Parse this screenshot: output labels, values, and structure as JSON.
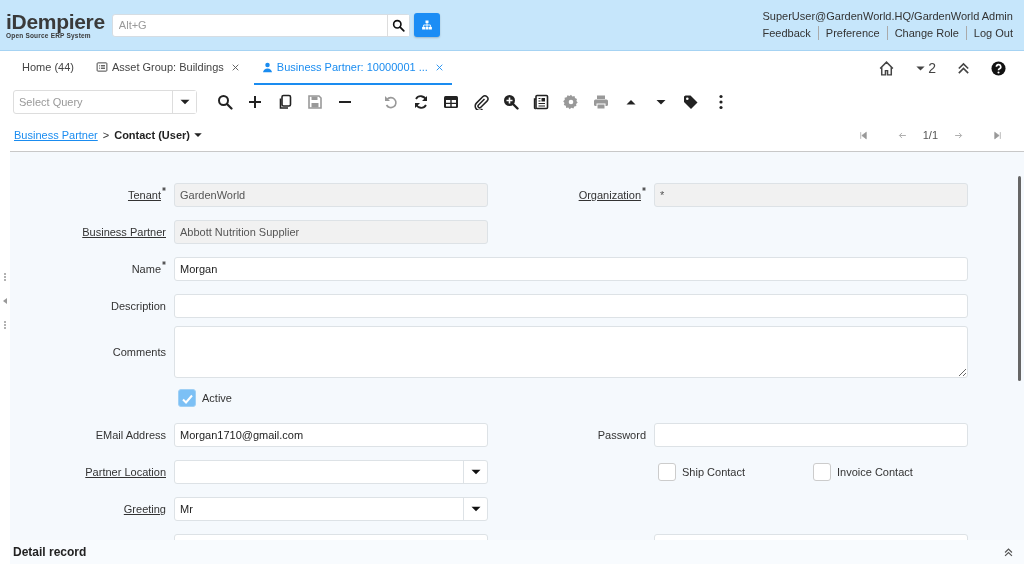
{
  "header": {
    "logo": "iDempiere",
    "tagline": "Open Source ERP System",
    "search": {
      "placeholder": "Alt+G"
    },
    "user": "SuperUser@GardenWorld.HQ/GardenWorld Admin",
    "links": [
      "Feedback",
      "Preference",
      "Change Role",
      "Log Out"
    ]
  },
  "tabs": [
    {
      "label": "Home (44)",
      "kind": "home",
      "closable": false,
      "selected": false
    },
    {
      "label": "Asset Group: Buildings",
      "kind": "list",
      "closable": true,
      "selected": false
    },
    {
      "label": "Business Partner: 10000001 ...",
      "kind": "person",
      "closable": true,
      "selected": true
    }
  ],
  "tab_tools": {
    "count": "2"
  },
  "toolbar": {
    "query": {
      "placeholder": "Select Query"
    },
    "buttons": [
      {
        "kind": "search",
        "disabled": false
      },
      {
        "kind": "new",
        "disabled": false
      },
      {
        "kind": "copy",
        "disabled": false
      },
      {
        "kind": "save",
        "disabled": true
      },
      {
        "kind": "delete",
        "disabled": false
      },
      {
        "kind": "undo",
        "disabled": true
      },
      {
        "kind": "refresh",
        "disabled": false
      },
      {
        "kind": "grid",
        "disabled": false
      },
      {
        "kind": "attach",
        "disabled": false
      },
      {
        "kind": "zoom",
        "disabled": false
      },
      {
        "kind": "report",
        "disabled": false
      },
      {
        "kind": "process",
        "disabled": true
      },
      {
        "kind": "print",
        "disabled": true
      },
      {
        "kind": "previous",
        "disabled": false
      },
      {
        "kind": "next",
        "disabled": false
      },
      {
        "kind": "tag",
        "disabled": false
      },
      {
        "kind": "more",
        "disabled": false
      }
    ]
  },
  "breadcrumb": {
    "parent": "Business Partner",
    "separator": ">",
    "current": "Contact (User)"
  },
  "navigator": {
    "position": "1/1"
  },
  "form": {
    "rows": [
      {
        "fields": [
          {
            "kind": "text",
            "label": "Tenant",
            "value": "GardenWorld",
            "linked": true,
            "mandatory": true,
            "readonly": true,
            "wide": false
          },
          {
            "kind": "text",
            "label": "Organization",
            "value": "*",
            "linked": true,
            "mandatory": true,
            "readonly": true,
            "wide": false
          }
        ]
      },
      {
        "fields": [
          {
            "kind": "text",
            "label": "Business Partner",
            "value": "Abbott Nutrition Supplier",
            "linked": true,
            "mandatory": false,
            "readonly": true,
            "wide": false
          }
        ]
      },
      {
        "fields": [
          {
            "kind": "text",
            "label": "Name",
            "value": "Morgan",
            "linked": false,
            "mandatory": true,
            "readonly": false,
            "wide": true
          }
        ]
      },
      {
        "fields": [
          {
            "kind": "text",
            "label": "Description",
            "linked": false,
            "mandatory": false,
            "readonly": false,
            "wide": true
          }
        ]
      },
      {
        "fields": [
          {
            "kind": "textarea",
            "label": "Comments",
            "linked": false,
            "mandatory": false,
            "readonly": false,
            "wide": true
          }
        ]
      },
      {
        "fields": [
          {
            "kind": "checks",
            "items": [
              {
                "label": "Active",
                "checked": true
              }
            ]
          }
        ]
      },
      {
        "fields": [
          {
            "kind": "text",
            "label": "EMail Address",
            "value": "Morgan1710@gmail.com",
            "linked": false,
            "mandatory": false,
            "readonly": false,
            "wide": false
          },
          {
            "kind": "text",
            "label": "Password",
            "linked": false,
            "mandatory": false,
            "readonly": false,
            "wide": false
          }
        ]
      },
      {
        "fields": [
          {
            "kind": "combo",
            "label": "Partner Location",
            "linked": true,
            "mandatory": false,
            "readonly": false
          },
          {
            "kind": "checks",
            "items": [
              {
                "label": "Ship Contact",
                "checked": false
              },
              {
                "label": "Invoice Contact",
                "checked": false
              }
            ]
          }
        ]
      },
      {
        "fields": [
          {
            "kind": "combo",
            "label": "Greeting",
            "value": "Mr",
            "linked": true,
            "mandatory": false,
            "readonly": false
          }
        ]
      },
      {
        "fields": [
          {
            "kind": "text",
            "readonly": false,
            "wide": false
          },
          {
            "kind": "text",
            "readonly": false,
            "wide": false
          }
        ]
      }
    ]
  },
  "detail": {
    "title": "Detail record"
  }
}
